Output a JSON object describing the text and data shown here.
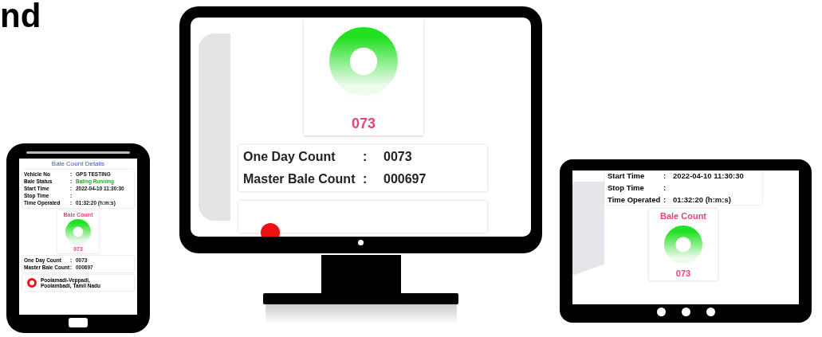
{
  "heading": "nd",
  "phone": {
    "title": "Bale Count Details",
    "details": [
      {
        "label": "Vehicle No",
        "colon": ":",
        "value": "GPS TESTING",
        "highlighted": false
      },
      {
        "label": "Bale Status",
        "colon": ":",
        "value": "Baling Running",
        "highlighted": true
      },
      {
        "label": "Start Time",
        "colon": ":",
        "value": "2022-04-10 11:30:30",
        "highlighted": false
      },
      {
        "label": "Stop Time",
        "colon": ":"
      },
      {
        "label": "Time Operated",
        "colon": ":",
        "value": "01:32:20 (h:m:s)",
        "highlighted": false
      }
    ],
    "bale_count": {
      "title": "Bale Count",
      "value": "073"
    },
    "counts": [
      {
        "label": "One Day Count",
        "colon": ":",
        "value": "0073"
      },
      {
        "label": "Master Bale Count",
        "colon": ":",
        "value": "000697"
      }
    ],
    "location": "Poolamadi-Veppadi,\nPoolambadi, Tamil Nadu"
  },
  "monitor": {
    "bale_count": {
      "value": "073"
    },
    "counts": [
      {
        "label": "One Day Count",
        "colon": ":",
        "value": "0073"
      },
      {
        "label": "Master Bale Count",
        "colon": ":",
        "value": "000697"
      }
    ]
  },
  "tablet": {
    "details": [
      {
        "label": "Start Time",
        "colon": ":",
        "value": "2022-04-10 11:30:30"
      },
      {
        "label": "Stop Time",
        "colon": ":"
      },
      {
        "label": "Time Operated",
        "colon": ":",
        "value": "01:32:20 (h:m:s)"
      }
    ],
    "bale_count": {
      "title": "Bale Count",
      "value": "073"
    }
  }
}
